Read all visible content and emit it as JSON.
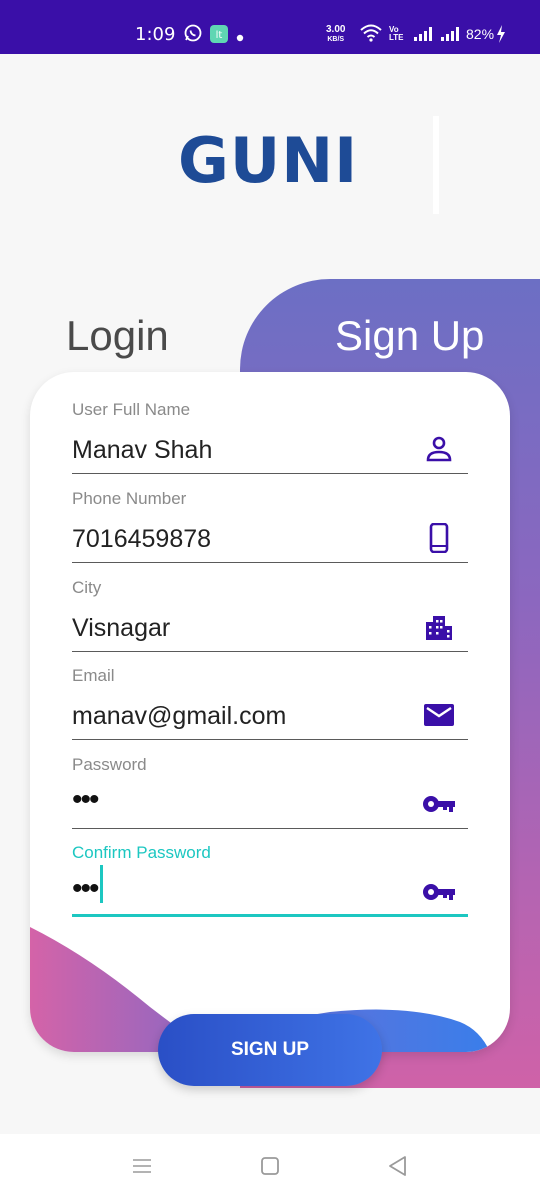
{
  "status_bar": {
    "time": "1:09",
    "speed_value": "3.00",
    "speed_unit": "KB/S",
    "volte": "Vo LTE",
    "battery": "82%",
    "icons": [
      "whatsapp-icon",
      "app-notification-icon",
      "dot-icon",
      "wifi-icon",
      "signal-icon",
      "signal-icon",
      "charging-icon"
    ]
  },
  "logo": {
    "text": "GUNI"
  },
  "tabs": {
    "login": "Login",
    "signup": "Sign Up"
  },
  "form": {
    "fields": [
      {
        "label": "User Full Name",
        "value": "Manav Shah",
        "icon": "person-icon"
      },
      {
        "label": "Phone Number",
        "value": "7016459878",
        "icon": "phone-icon"
      },
      {
        "label": "City",
        "value": "Visnagar",
        "icon": "city-icon"
      },
      {
        "label": "Email",
        "value": "manav@gmail.com",
        "icon": "mail-icon"
      },
      {
        "label": "Password",
        "value": "•••",
        "icon": "key-icon"
      },
      {
        "label": "Confirm Password",
        "value": "•••",
        "icon": "key-icon",
        "focused": true
      }
    ]
  },
  "button": {
    "label": "SIGN UP"
  },
  "colors": {
    "accent": "#3a0fa8",
    "logo": "#1e4b96",
    "focus": "#1cc7c1",
    "button": "#2a4fc6"
  },
  "nav_bar": {
    "icons": [
      "menu-icon",
      "home-icon",
      "back-icon"
    ]
  }
}
